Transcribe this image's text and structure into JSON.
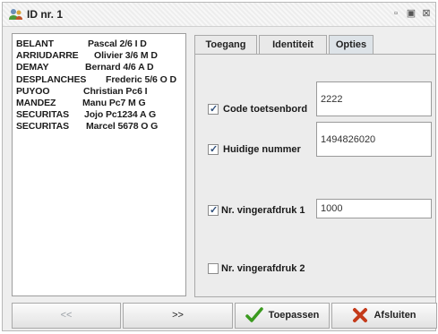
{
  "window": {
    "title": "ID nr. 1"
  },
  "list": {
    "items": [
      {
        "surname": "BELANT",
        "detail": "Pascal 2/6 I D"
      },
      {
        "surname": "ARRIUDARRE",
        "detail": "Olivier 3/6 M D"
      },
      {
        "surname": "DEMAY",
        "detail": "Bernard 4/6 A D"
      },
      {
        "surname": "DESPLANCHES",
        "detail": "Frederic 5/6 O D"
      },
      {
        "surname": "PUYOO",
        "detail": "Christian Pc6 I"
      },
      {
        "surname": "MANDEZ",
        "detail": "Manu Pc7 M G"
      },
      {
        "surname": "SECURITAS",
        "detail": "Jojo Pc1234 A G"
      },
      {
        "surname": "SECURITAS",
        "detail": "Marcel 5678 O G"
      }
    ]
  },
  "tabs": [
    {
      "label": "Toegang",
      "active": false
    },
    {
      "label": "Identiteit",
      "active": false
    },
    {
      "label": "Opties",
      "active": true
    }
  ],
  "options": {
    "code_toetsenbord": {
      "label": "Code toetsenbord",
      "checked": true,
      "value": "2222"
    },
    "huidige_nummer": {
      "label": "Huidige nummer",
      "checked": true,
      "value": "1494826020"
    },
    "vingerafdruk1": {
      "label": "Nr. vingerafdruk  1",
      "checked": true,
      "value": "1000"
    },
    "vingerafdruk2": {
      "label": "Nr. vingerafdruk  2",
      "checked": false
    }
  },
  "buttons": {
    "prev": "<<",
    "next": ">>",
    "apply": "Toepassen",
    "close": "Afsluiten"
  },
  "colors": {
    "accent": "#2e4e7a",
    "apply_icon": "#3a9a1e",
    "close_icon": "#c43a1a"
  }
}
